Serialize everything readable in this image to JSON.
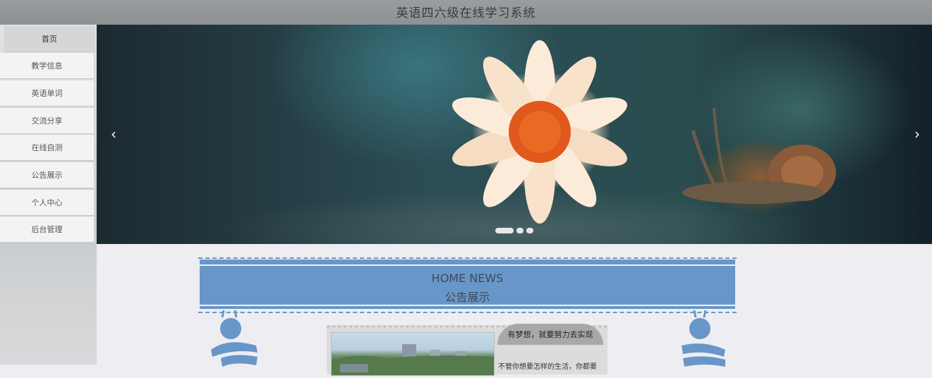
{
  "header": {
    "title": "英语四六级在线学习系统"
  },
  "sidebar": {
    "items": [
      {
        "label": "首页"
      },
      {
        "label": "教学信息"
      },
      {
        "label": "英语单词"
      },
      {
        "label": "交流分享"
      },
      {
        "label": "在线自测"
      },
      {
        "label": "公告展示"
      },
      {
        "label": "个人中心"
      },
      {
        "label": "后台管理"
      }
    ]
  },
  "carousel": {
    "prev_icon": "chevron-left-icon",
    "next_icon": "chevron-right-icon",
    "prev_glyph": "‹",
    "next_glyph": "›",
    "slide_count": 3,
    "active_slide": 1
  },
  "news": {
    "heading_en": "HOME NEWS",
    "heading_cn": "公告展示",
    "card": {
      "title": "有梦想，就要努力去实现",
      "text": "不管你想要怎样的生活，你都要"
    }
  },
  "colors": {
    "accent": "#6896c8",
    "topbar": "#95989b"
  }
}
